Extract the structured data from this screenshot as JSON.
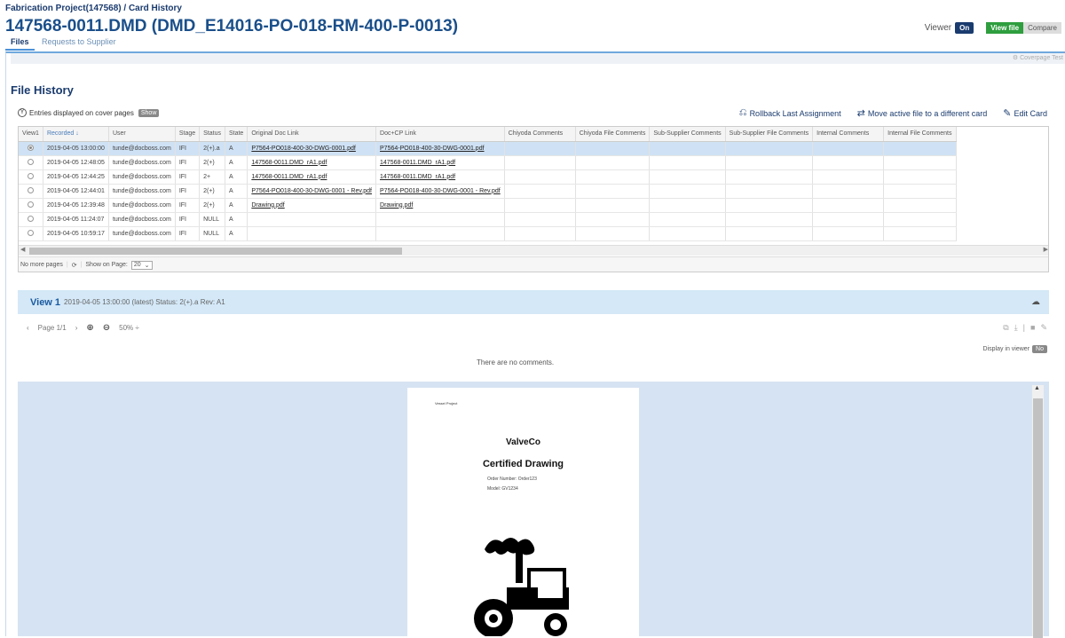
{
  "header": {
    "project": "Fabrication Project(147568)",
    "crumb_sep": " / ",
    "crumb_current": "Card History",
    "title": "147568-0011.DMD (DMD_E14016-PO-018-RM-400-P-0013)",
    "tabs": [
      {
        "label": "Files",
        "active": true
      },
      {
        "label": "Requests to Supplier",
        "active": false
      }
    ],
    "viewer_label": "Viewer",
    "viewer_state": "On",
    "view_file": "View file",
    "compare": "Compare"
  },
  "coverpage": "⚙ Coverpage Test",
  "file_history": {
    "title": "File History",
    "entries_text": "Entries displayed on cover pages",
    "show_btn": "Show",
    "actions": [
      {
        "label": "Rollback Last Assignment",
        "icon": "rollback-icon"
      },
      {
        "label": "Move active file to a different card",
        "icon": "move-icon"
      },
      {
        "label": "Edit Card",
        "icon": "edit-icon"
      }
    ],
    "columns": [
      "View1",
      "Recorded ↓",
      "User",
      "Stage",
      "Status",
      "State",
      "Original Doc Link",
      "Doc+CP Link",
      "Chiyoda Comments",
      "Chiyoda File Comments",
      "Sub-Supplier Comments",
      "Sub-Supplier File Comments",
      "Internal Comments",
      "Internal File Comments"
    ],
    "rows": [
      [
        "2019-04-05 13:00:00",
        "tunde@docboss.com",
        "IFI",
        "2(+).a",
        "A",
        "P7564-PO018-400-30-DWG-0001.pdf",
        "P7564-PO018-400-30-DWG-0001.pdf"
      ],
      [
        "2019-04-05 12:48:05",
        "tunde@docboss.com",
        "IFI",
        "2(+)",
        "A",
        "147568-0011.DMD_rA1.pdf",
        "147568-0011.DMD_rA1.pdf"
      ],
      [
        "2019-04-05 12:44:25",
        "tunde@docboss.com",
        "IFI",
        "2+",
        "A",
        "147568-0011.DMD_rA1.pdf",
        "147568-0011.DMD_rA1.pdf"
      ],
      [
        "2019-04-05 12:44:01",
        "tunde@docboss.com",
        "IFI",
        "2(+)",
        "A",
        "P7564-PO018-400-30-DWG-0001 - Rev.pdf",
        "P7564-PO018-400-30-DWG-0001 - Rev.pdf"
      ],
      [
        "2019-04-05 12:39:48",
        "tunde@docboss.com",
        "IFI",
        "2(+)",
        "A",
        "Drawing.pdf",
        "Drawing.pdf"
      ],
      [
        "2019-04-05 11:24:07",
        "tunde@docboss.com",
        "IFI",
        "NULL",
        "A",
        "",
        ""
      ],
      [
        "2019-04-05 10:59:17",
        "tunde@docboss.com",
        "IFI",
        "NULL",
        "A",
        "",
        ""
      ]
    ],
    "pager": {
      "no_more": "No more pages",
      "show_on_page_label": "Show on Page:",
      "show_on_page_value": "20"
    }
  },
  "view": {
    "label": "View 1",
    "info": "2019-04-05 13:00:00 (latest) Status: 2(+).a Rev: A1",
    "page_text": "Page 1/1",
    "zoom": "50% ÷",
    "display_in_viewer": "Display in viewer",
    "display_value": "No",
    "no_comments": "There are no comments."
  },
  "document": {
    "small_text": "Vessel Project",
    "brand": "ValveCo",
    "heading": "Certified Drawing",
    "order_number": "Order Number: Order123",
    "model": "Model: GV1234"
  }
}
